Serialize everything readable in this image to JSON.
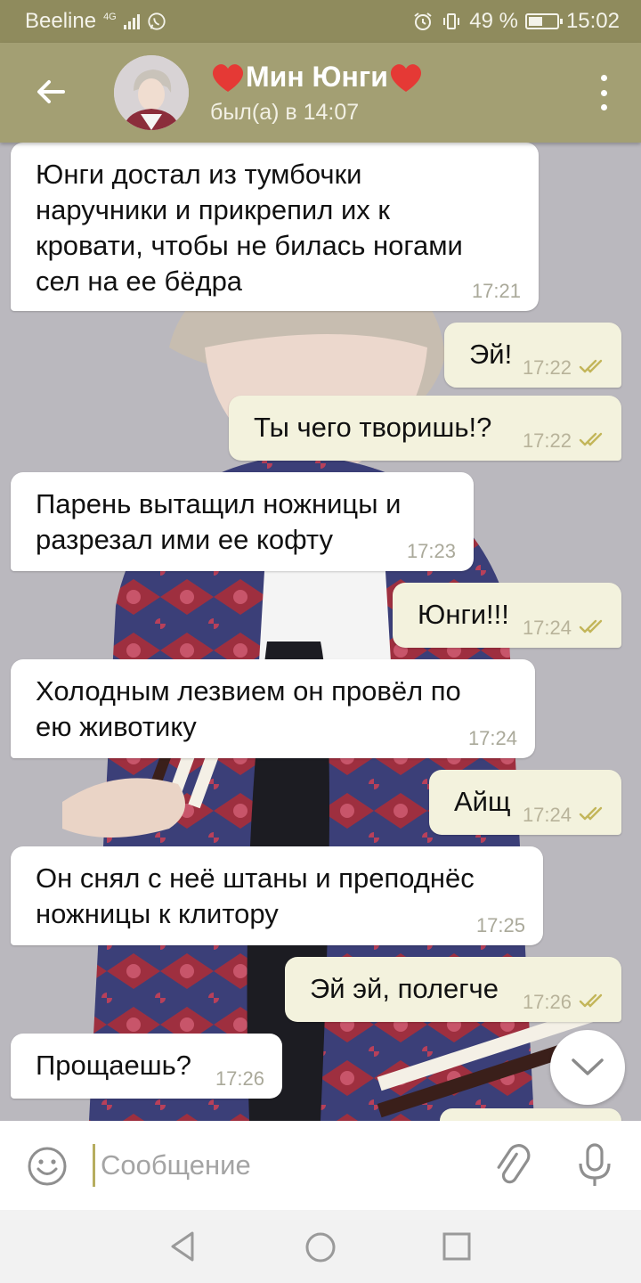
{
  "status_bar": {
    "carrier": "Beeline",
    "network": "4G",
    "battery": "49 %",
    "battery_level": 0.49,
    "time": "15:02"
  },
  "header": {
    "title": "Мин Юнги",
    "status": "был(а) в 14:07"
  },
  "messages": [
    {
      "side": "in",
      "text": "Юнги достал из тумбочки\nнаручники и прикрепил их к\nкровати, чтобы не билась ногами\nсел на ее бёдра",
      "time": "17:21"
    },
    {
      "side": "out",
      "text": "Эй!",
      "time": "17:22",
      "read": true
    },
    {
      "side": "out",
      "text": "Ты чего творишь!?",
      "time": "17:22",
      "read": true
    },
    {
      "side": "in",
      "text": "Парень вытащил ножницы и\nразрезал ими ее кофту",
      "time": "17:23"
    },
    {
      "side": "out",
      "text": "Юнги!!!",
      "time": "17:24",
      "read": true
    },
    {
      "side": "in",
      "text": "Холодным лезвием он провёл по\nею животику",
      "time": "17:24"
    },
    {
      "side": "out",
      "text": "Айщ",
      "time": "17:24",
      "read": true
    },
    {
      "side": "in",
      "text": "Он снял с неё штаны и преподнёс\nножницы к клитору",
      "time": "17:25"
    },
    {
      "side": "out",
      "text": "Эй эй, полегче",
      "time": "17:26",
      "read": true
    },
    {
      "side": "in",
      "text": "Прощаешь?",
      "time": "17:26"
    }
  ],
  "composer": {
    "placeholder": "Сообщение"
  },
  "colors": {
    "header": "#a39f73",
    "status_bar": "#8f8b5d",
    "incoming_bubble": "#ffffff",
    "outgoing_bubble": "#f3f2dd",
    "read_check": "#c3b65a",
    "heart": "#e53935"
  },
  "icons": {
    "back": "arrow-left-icon",
    "menu": "kebab-menu-icon",
    "scroll_down": "chevron-down-icon",
    "emoji": "smiley-icon",
    "attach": "paperclip-icon",
    "mic": "microphone-icon"
  }
}
